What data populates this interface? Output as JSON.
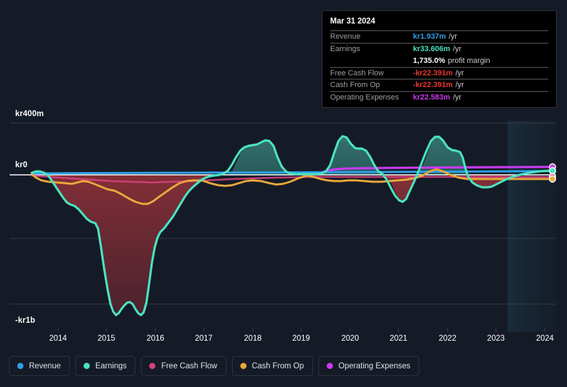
{
  "background_color": "#151b26",
  "tooltip": {
    "date": "Mar 31 2024",
    "rows": [
      {
        "key": "Revenue",
        "value": "kr1.937m",
        "suffix": "/yr",
        "color": "#2f9fe8"
      },
      {
        "key": "Earnings",
        "value": "kr33.606m",
        "suffix": "/yr",
        "color": "#4ae3c0"
      },
      {
        "key": "",
        "value": "1,735.0%",
        "suffix": "profit margin",
        "color": "#ffffff"
      },
      {
        "key": "Free Cash Flow",
        "value": "-kr22.391m",
        "suffix": "/yr",
        "color": "#e8392f"
      },
      {
        "key": "Cash From Op",
        "value": "-kr22.391m",
        "suffix": "/yr",
        "color": "#e8392f"
      },
      {
        "key": "Operating Expenses",
        "value": "kr22.583m",
        "suffix": "/yr",
        "color": "#c83bef"
      }
    ]
  },
  "legend": {
    "items": [
      {
        "label": "Revenue",
        "color": "#2f9fe8"
      },
      {
        "label": "Earnings",
        "color": "#4ae3c0"
      },
      {
        "label": "Free Cash Flow",
        "color": "#d6417e"
      },
      {
        "label": "Cash From Op",
        "color": "#e8a83c"
      },
      {
        "label": "Operating Expenses",
        "color": "#c83bef"
      }
    ]
  },
  "chart_data": {
    "type": "area",
    "title": "",
    "xlabel": "",
    "ylabel": "",
    "currency_prefix": "kr",
    "grid": true,
    "legend_position": "bottom",
    "ylim": [
      -1000000000,
      400000000
    ],
    "y_ticks": [
      {
        "label": "kr400m",
        "value": 400000000
      },
      {
        "label": "kr0",
        "value": 0
      },
      {
        "label": "-kr1b",
        "value": -1000000000
      }
    ],
    "x_ticks": [
      "2014",
      "2015",
      "2016",
      "2017",
      "2018",
      "2019",
      "2020",
      "2021",
      "2022",
      "2023",
      "2024"
    ],
    "x_range": [
      2013.4,
      2024.4
    ],
    "highlight_region": {
      "from": 2023.3,
      "to": 2024.4,
      "label": ""
    },
    "series": [
      {
        "name": "Revenue",
        "color": "#2f9fe8",
        "values_m": [
          2,
          2,
          2,
          2,
          2,
          2,
          2,
          2,
          2,
          2,
          2,
          2,
          2,
          2,
          2,
          2,
          2,
          2,
          2,
          2,
          2,
          2,
          2,
          2,
          2,
          2,
          2,
          2,
          2,
          2,
          2,
          2,
          2,
          2,
          2,
          2,
          2,
          2,
          2,
          2,
          2,
          2,
          2,
          2,
          2
        ]
      },
      {
        "name": "Earnings",
        "color": "#4ae3c0",
        "values_m": [
          20,
          22,
          10,
          -60,
          -130,
          -175,
          -180,
          -182,
          -200,
          -260,
          -290,
          -300,
          -460,
          -700,
          -880,
          -930,
          -790,
          -845,
          -900,
          -620,
          -400,
          -310,
          -280,
          -230,
          -160,
          -110,
          -70,
          -10,
          120,
          175,
          180,
          185,
          200,
          215,
          60,
          35,
          30,
          32,
          270,
          235,
          230,
          130,
          -80,
          -130,
          -40,
          60,
          230,
          280,
          175,
          170,
          95,
          -15,
          -55,
          -60,
          -40,
          -20,
          10,
          25,
          33.6
        ]
      },
      {
        "name": "Free Cash Flow",
        "color": "#d6417e",
        "values_m": [
          -10,
          -12,
          -14,
          -20,
          -24,
          -26,
          -28,
          -30,
          -34,
          -40,
          -46,
          -50,
          -56,
          -60,
          -62,
          -64,
          -64,
          -62,
          -60,
          -56,
          -50,
          -44,
          -40,
          -36,
          -32,
          -28,
          -24,
          -22,
          -20,
          -20,
          -20,
          -20,
          -22,
          -22,
          -22,
          -22,
          -22,
          -22,
          -22,
          -22,
          -22.4
        ]
      },
      {
        "name": "Cash From Op",
        "color": "#e8a83c",
        "values_m": [
          -10,
          -26,
          -30,
          -32,
          -34,
          -33,
          -36,
          -40,
          -44,
          -46,
          -38,
          -34,
          -40,
          -48,
          -52,
          -50,
          -60,
          -75,
          -95,
          -110,
          -112,
          -100,
          -82,
          -66,
          -50,
          -36,
          -26,
          -22,
          -24,
          -35,
          -40,
          -42,
          -40,
          -30,
          -18,
          -16,
          -20,
          -30,
          -34,
          -30,
          -22,
          -8,
          14,
          20,
          8,
          -6,
          -18,
          -22,
          -22,
          -22.4
        ]
      },
      {
        "name": "Operating Expenses",
        "color": "#c83bef",
        "values_m": [
          0,
          0,
          0,
          0,
          0,
          0,
          0,
          0,
          0,
          0,
          0,
          0,
          0,
          0,
          0,
          0,
          0,
          0,
          0,
          0,
          0,
          0,
          0,
          0,
          0,
          0,
          0,
          18,
          20,
          21,
          21,
          21,
          22,
          22,
          22,
          22,
          22,
          22,
          22,
          22,
          22.6
        ]
      }
    ]
  }
}
